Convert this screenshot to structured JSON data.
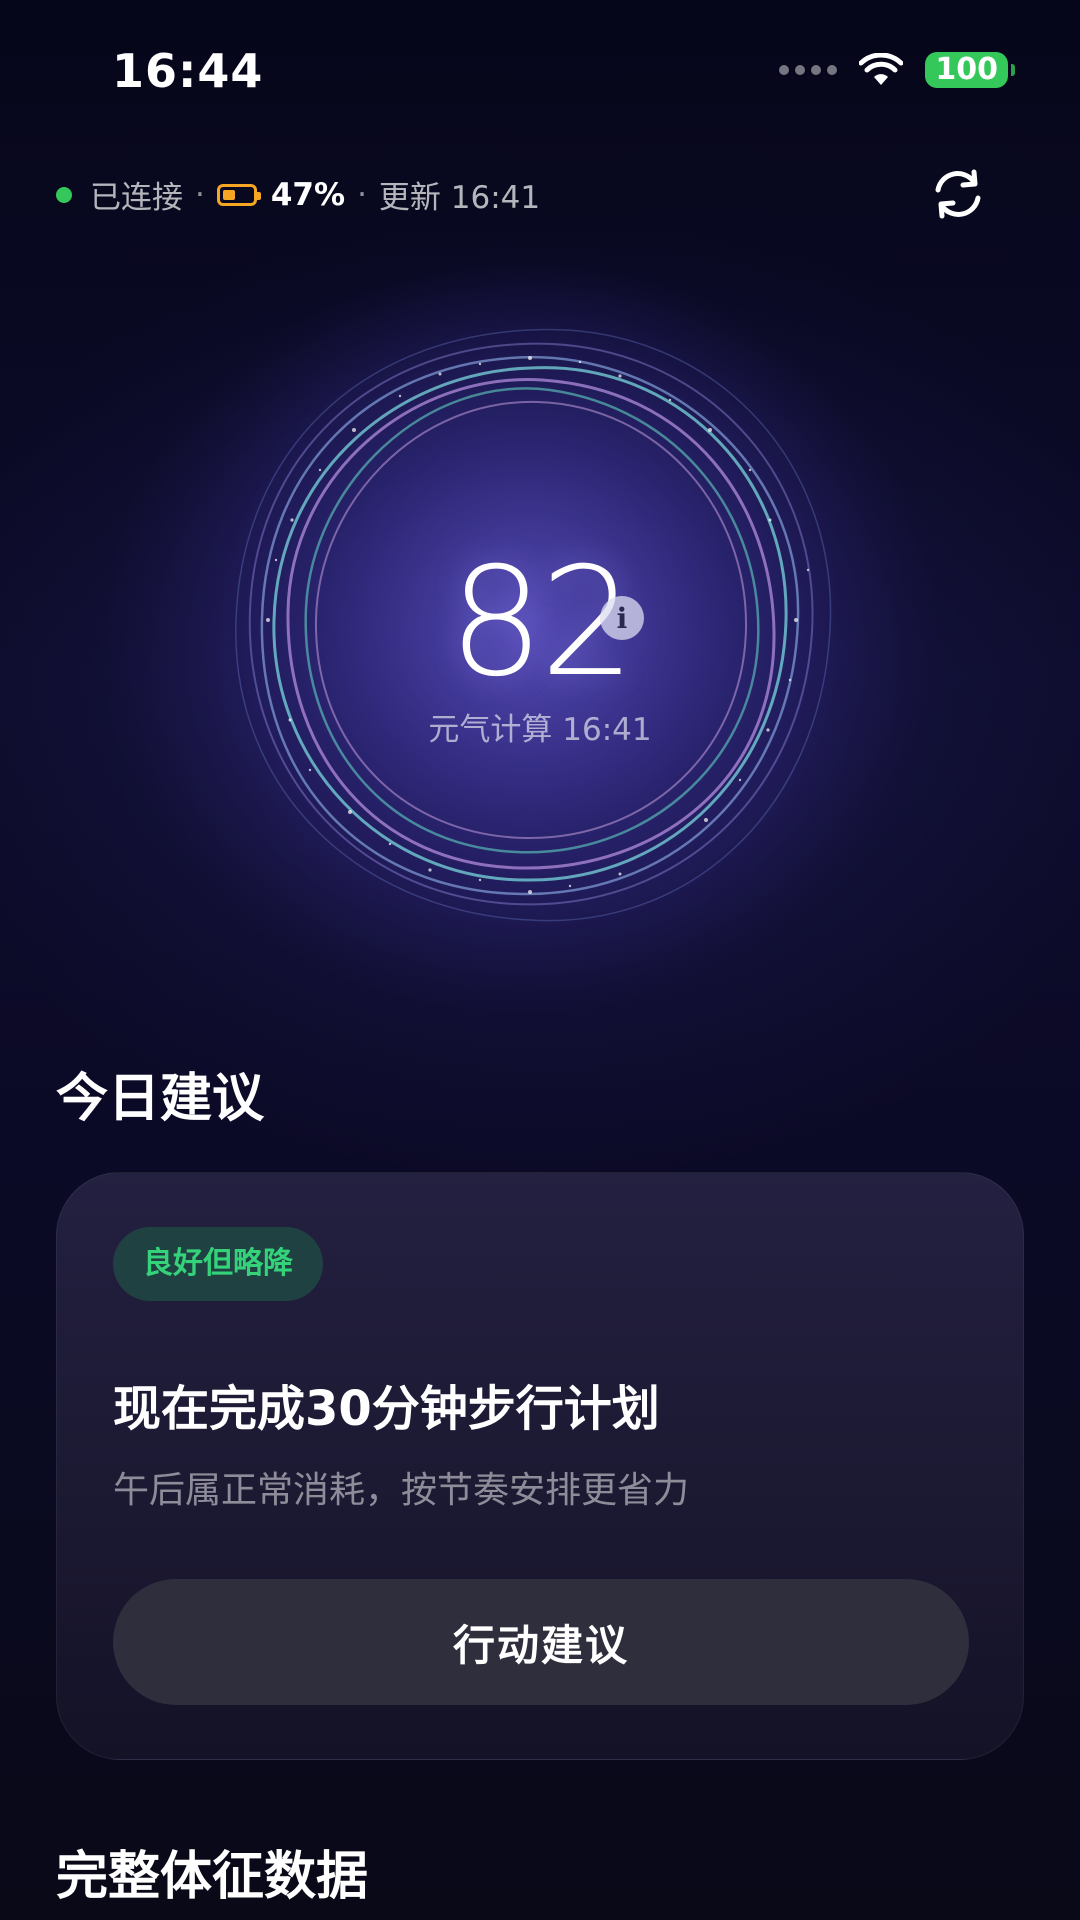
{
  "status_bar": {
    "time": "16:44",
    "battery_level": "100",
    "signal_icon": "signal-dots-icon",
    "wifi_icon": "wifi-icon"
  },
  "connection": {
    "status": "已连接",
    "separator": "·",
    "device_battery": "47%",
    "update": "更新 16:41",
    "refresh_icon": "refresh-icon"
  },
  "score": {
    "value": "82",
    "info_glyph": "i",
    "subtitle": "元气计算 16:41"
  },
  "advice": {
    "section_title": "今日建议",
    "badge": "良好但略降",
    "title": "现在完成30分钟步行计划",
    "subtitle": "午后属正常消耗，按节奏安排更省力",
    "action_label": "行动建议"
  },
  "vitals": {
    "section_title": "完整体征数据"
  },
  "colors": {
    "accent_green": "#34c759",
    "badge_green": "#34d37a",
    "device_battery_orange": "#f5a623"
  }
}
